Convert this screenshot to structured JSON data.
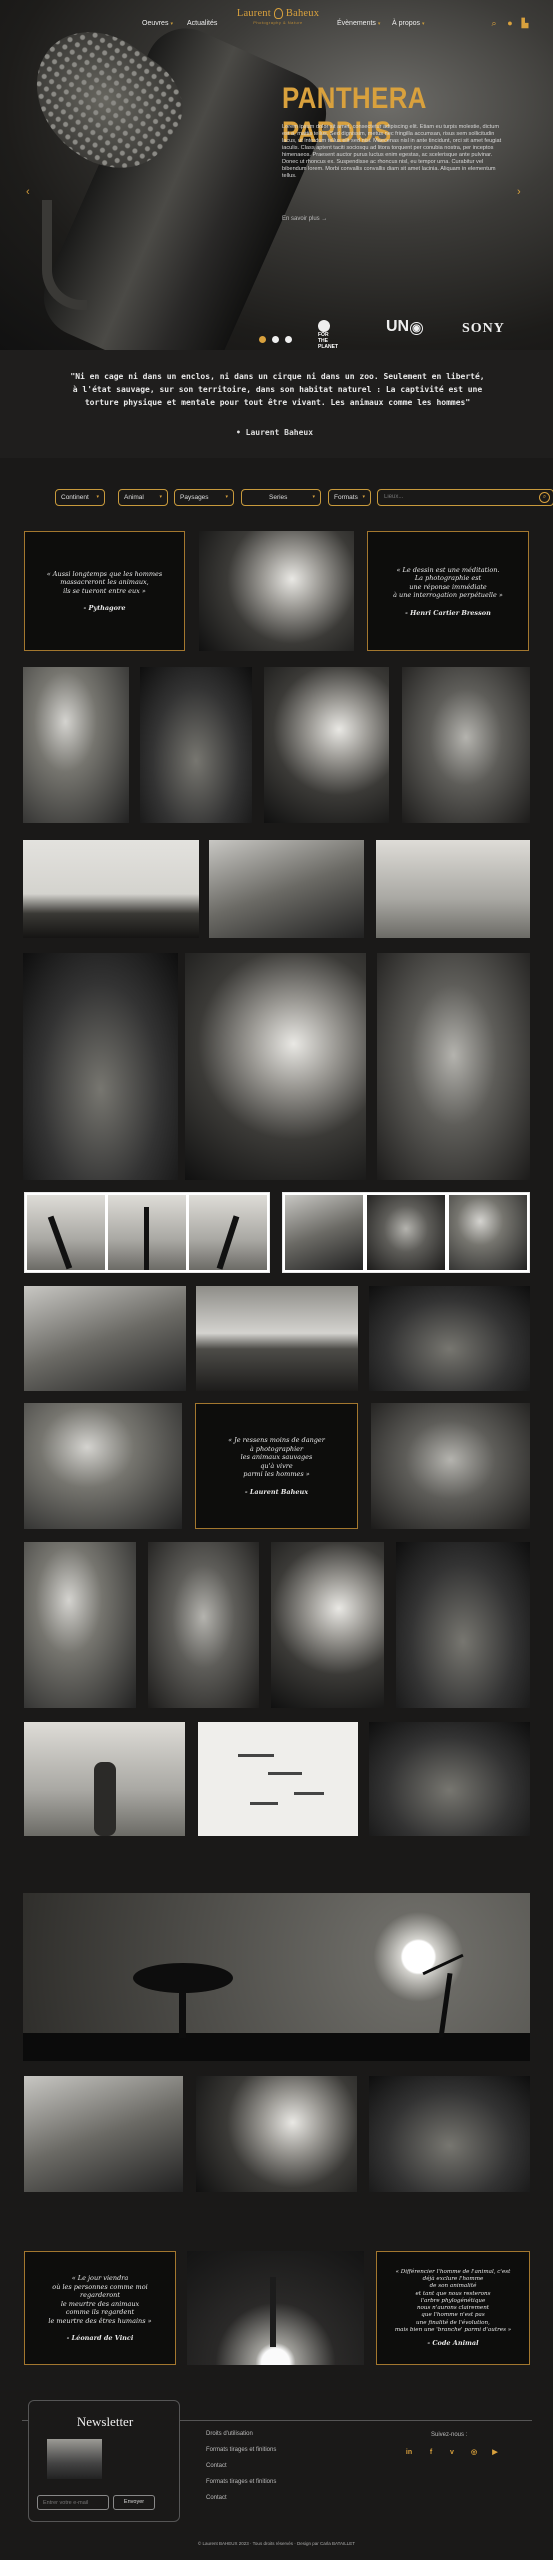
{
  "nav": {
    "left": [
      {
        "label": "Oeuvres"
      },
      {
        "label": "Actualités"
      }
    ],
    "right": [
      {
        "label": "Évènements"
      },
      {
        "label": "À propos"
      }
    ],
    "logo": {
      "name_first": "Laurent",
      "name_last": "Baheux",
      "tagline": "Photography & Nature"
    },
    "icons": [
      "search-icon",
      "user-icon",
      "cart-icon"
    ]
  },
  "hero": {
    "title": "PANTHERA PARDUS",
    "text": "Lorem ipsum dolor sit amet, consectetur adipiscing elit. Etiam eu turpis molestie, dictum est a, mattis tellus. Sed dignissim, metus nec fringilla accumsan, risus sem sollicitudin lacus, ut interdum tellus elit sed nisi. Maecenas nisl in ante tincidunt, orci sit amet feugiat iaculis. Class aptent taciti sociosqu ad litora torquent per conubia nostra, per inceptos himenaeos. Praesent auctor purus luctus enim egestas, ac scelerisque ante pulvinar. Donec ut rhoncus ex. Suspendisse ac rhoncus nisl, eu tempor urna. Curabitur vel bibendum lorem. Morbi convallis convallis diam sit amet lacinia. Aliquam in elementum tellus.",
    "link": "En savoir plus  →",
    "partners": [
      "FOR THE PLANET",
      "UN",
      "SONY"
    ]
  },
  "quote": {
    "text": "\"Ni en cage ni dans un enclos, ni dans un cirque ni dans un zoo. Seulement en liberté, à l'état sauvage, sur son territoire, dans son habitat naturel : La captivité est une torture physique et mentale pour tout être vivant. Les animaux comme les hommes\"",
    "author": "•  Laurent Baheux"
  },
  "filters": {
    "items": [
      "Continent",
      "Animal",
      "Paysages",
      "Series",
      "Formats"
    ],
    "search_placeholder": "Lieux..."
  },
  "quotes": [
    {
      "text": "« Aussi longtemps que les hommes\nmassacreront les animaux,\nils se tueront entre eux »",
      "author": "- Pythagore"
    },
    {
      "text": "« Le dessin est une méditation.\nLa photographie est\nune réponse immédiate\nà une interrogation perpétuelle »",
      "author": "- Henri Cartier Bresson"
    },
    {
      "text": "« Je ressens moins de danger\nà photographier\nles animaux sauvages\nqu'à vivre\nparmi les hommes »",
      "author": "- Laurent Baheux"
    },
    {
      "text": "« Le jour viendra\noù les personnes comme moi\nregarderont\nle meurtre des animaux\ncomme ils regardent\nle meurtre des êtres humains »",
      "author": "- Léonard de Vinci"
    },
    {
      "text": "« Différencier l'homme de l'animal, c'est\ndéjà exclure l'homme\nde son animalité\net tant que nous resterons\nl'arbre phylogénétique\nnous n'aurons clairement\nque l'homme n'est pas\nune finalité de l'évolution,\nmais bien une 'branche' parmi d'autres »",
      "author": "- Code Animal"
    }
  ],
  "footer": {
    "newsletter_title": "Newsletter",
    "email_placeholder": "Entrer votre e-mail",
    "send_label": "Envoyer",
    "links": [
      "Droits d'utilisation",
      "Formats tirages et finitions",
      "Contact",
      "Formats tirages et finitions",
      "Contact"
    ],
    "follow_label": "Suivez-nous :",
    "socials": [
      "linkedin-icon",
      "facebook-icon",
      "vimeo-icon",
      "instagram-icon",
      "youtube-icon"
    ],
    "copyright": "© Laurent BAHEUX 2023 · Tous droits réservés · Design par Carla BATAILLET"
  },
  "colors": {
    "accent": "#d9a13d",
    "background": "#1a1918",
    "text": "#e9e9e9"
  }
}
